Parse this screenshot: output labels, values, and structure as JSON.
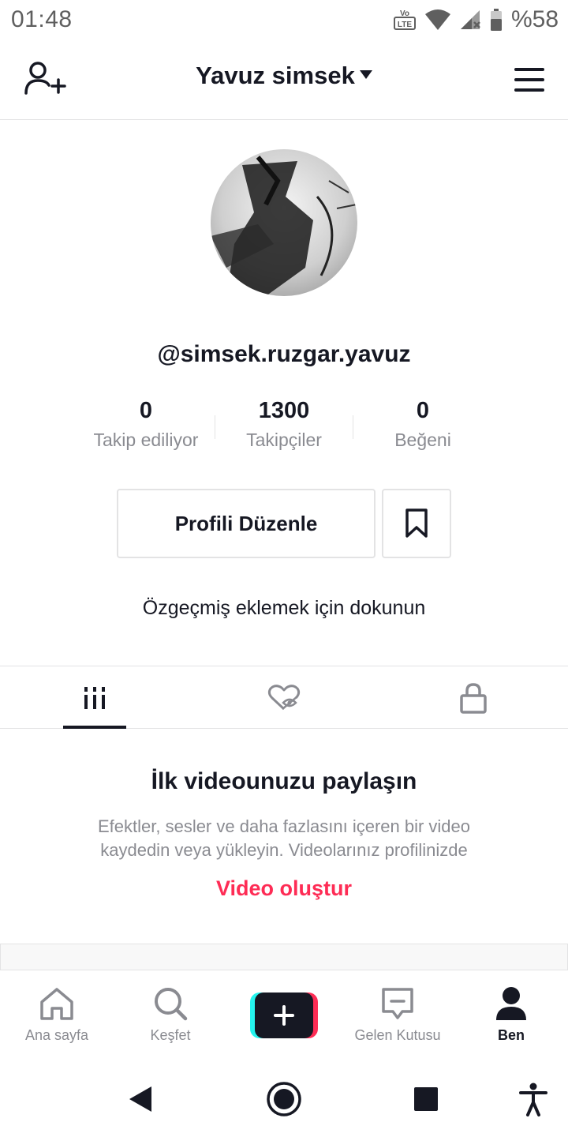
{
  "status_bar": {
    "time": "01:48",
    "battery": "%58",
    "icons": [
      "volte-icon",
      "wifi-icon",
      "signal-icon",
      "battery-icon"
    ]
  },
  "header": {
    "account_name": "Yavuz simsek",
    "left_icon": "add-user-icon",
    "right_icon": "menu-icon"
  },
  "profile": {
    "username": "@simsek.ruzgar.yavuz",
    "stats": [
      {
        "value": "0",
        "label": "Takip ediliyor"
      },
      {
        "value": "1300",
        "label": "Takipçiler"
      },
      {
        "value": "0",
        "label": "Beğeni"
      }
    ],
    "edit_button": "Profili Düzenle",
    "bookmark_icon": "bookmark-icon",
    "bio_prompt": "Özgeçmiş eklemek için dokunun"
  },
  "tabs": [
    {
      "icon": "videos-grid-icon",
      "active": true
    },
    {
      "icon": "liked-hidden-icon",
      "active": false
    },
    {
      "icon": "lock-icon",
      "active": false
    }
  ],
  "empty_state": {
    "title": "İlk videounuzu paylaşın",
    "description": "Efektler, sesler ve daha fazlasını içeren bir video kaydedin veya yükleyin. Videolarınız profilinizde",
    "action": "Video oluştur"
  },
  "bottom_nav": [
    {
      "label": "Ana sayfa",
      "icon": "home-icon",
      "active": false
    },
    {
      "label": "Keşfet",
      "icon": "search-icon",
      "active": false
    },
    {
      "label": "",
      "icon": "plus-icon",
      "active": false
    },
    {
      "label": "Gelen Kutusu",
      "icon": "inbox-icon",
      "active": false
    },
    {
      "label": "Ben",
      "icon": "profile-icon",
      "active": true
    }
  ],
  "colors": {
    "text": "#161823",
    "secondary_text": "#8a8b91",
    "accent": "#fe2c55",
    "cyan": "#25f4ee",
    "border": "#e3e3e4"
  }
}
